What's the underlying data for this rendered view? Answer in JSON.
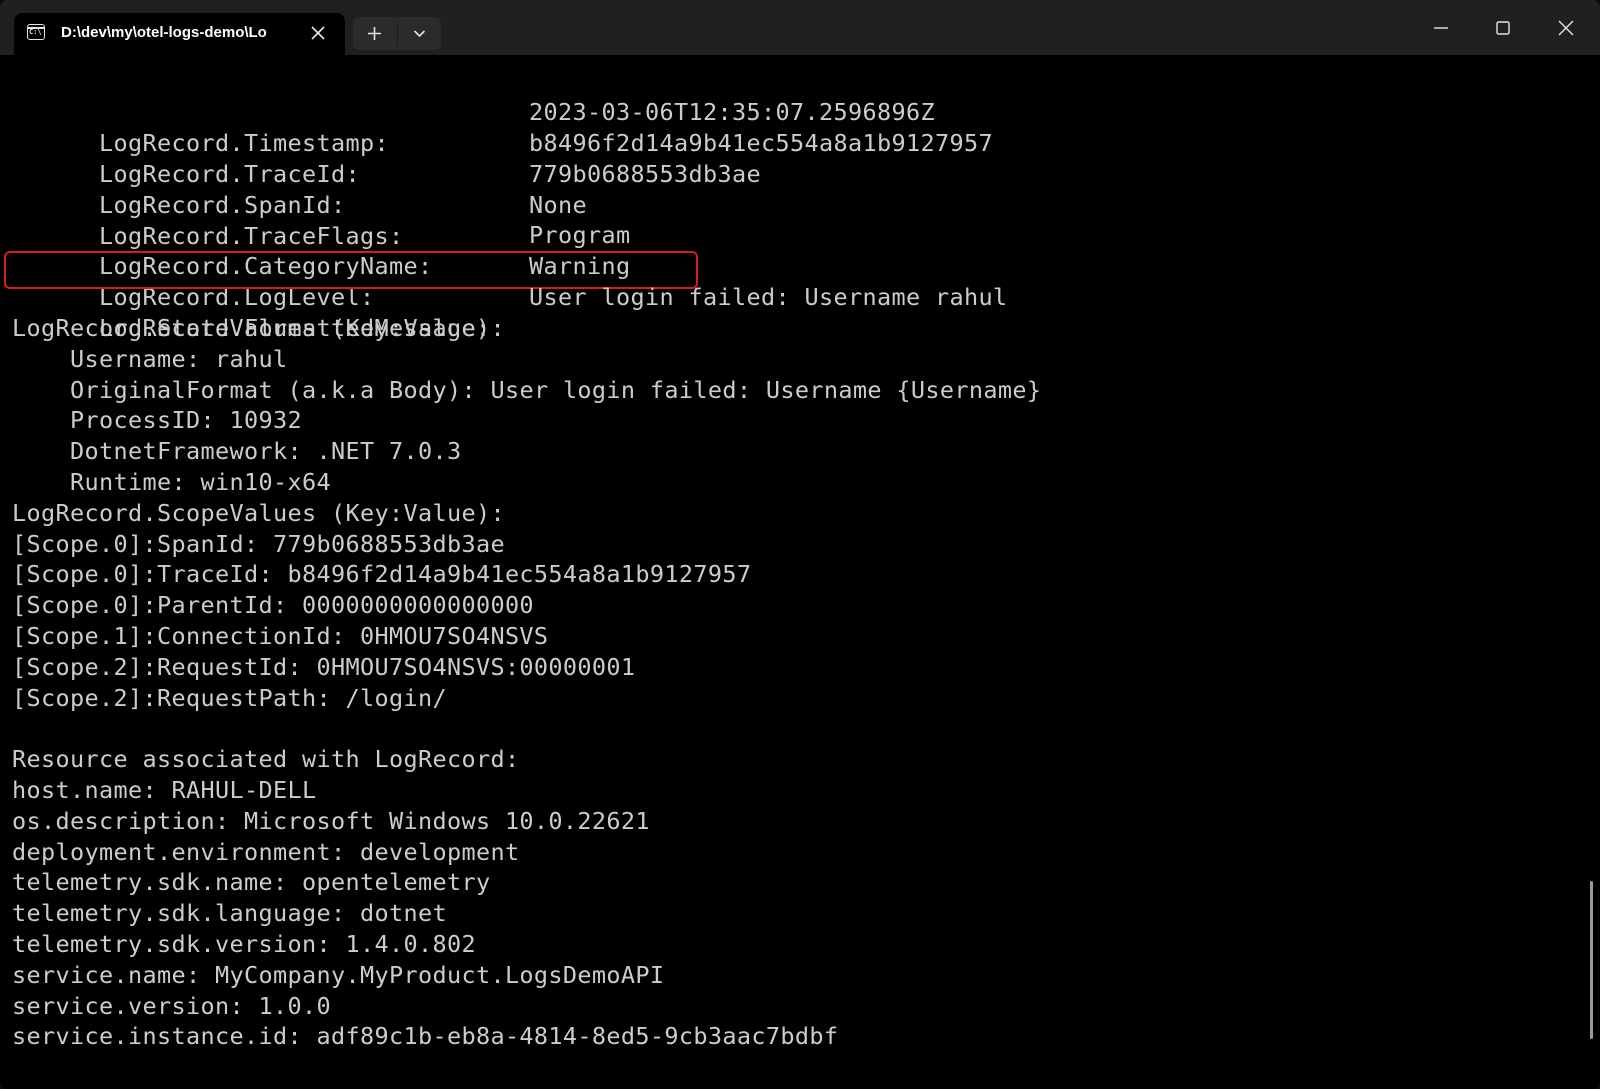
{
  "window": {
    "tab_title": "D:\\dev\\my\\otel-logs-demo\\Lo",
    "tab_icon": "terminal-icon",
    "tab_close_icon": "close-icon",
    "new_tab_icon": "plus-icon",
    "dropdown_icon": "chevron-down-icon",
    "controls": {
      "minimize_icon": "minimize-icon",
      "maximize_icon": "maximize-icon",
      "close_icon": "close-icon"
    }
  },
  "colors": {
    "terminal_background": "#000000",
    "terminal_text": "#cccccc",
    "titlebar_background": "#202020",
    "highlight_border": "#d41d1d"
  },
  "log_record": {
    "fields": [
      {
        "key": "LogRecord.Timestamp:",
        "value": "2023-03-06T12:35:07.2596896Z"
      },
      {
        "key": "LogRecord.TraceId:",
        "value": "b8496f2d14a9b41ec554a8a1b9127957"
      },
      {
        "key": "LogRecord.SpanId:",
        "value": "779b0688553db3ae"
      },
      {
        "key": "LogRecord.TraceFlags:",
        "value": "None"
      },
      {
        "key": "LogRecord.CategoryName:",
        "value": "Program"
      },
      {
        "key": "LogRecord.LogLevel:",
        "value": "Warning",
        "highlighted": true
      },
      {
        "key": "LogRecord.FormattedMessage:",
        "value": "User login failed: Username rahul"
      }
    ],
    "state_values_header": "LogRecord.StateValues (Key:Value):",
    "state_values": [
      "Username: rahul",
      "OriginalFormat (a.k.a Body): User login failed: Username {Username}",
      "ProcessID: 10932",
      "DotnetFramework: .NET 7.0.3",
      "Runtime: win10-x64"
    ],
    "scope_values_header": "LogRecord.ScopeValues (Key:Value):",
    "scope_values": [
      "[Scope.0]:SpanId: 779b0688553db3ae",
      "[Scope.0]:TraceId: b8496f2d14a9b41ec554a8a1b9127957",
      "[Scope.0]:ParentId: 0000000000000000",
      "[Scope.1]:ConnectionId: 0HMOU7SO4NSVS",
      "[Scope.2]:RequestId: 0HMOU7SO4NSVS:00000001",
      "[Scope.2]:RequestPath: /login/"
    ]
  },
  "resource": {
    "header": "Resource associated with LogRecord:",
    "attributes": [
      "host.name: RAHUL-DELL",
      "os.description: Microsoft Windows 10.0.22621",
      "deployment.environment: development",
      "telemetry.sdk.name: opentelemetry",
      "telemetry.sdk.language: dotnet",
      "telemetry.sdk.version: 1.4.0.802",
      "service.name: MyCompany.MyProduct.LogsDemoAPI",
      "service.version: 1.0.0",
      "service.instance.id: adf89c1b-eb8a-4814-8ed5-9cb3aac7bdbf"
    ]
  }
}
